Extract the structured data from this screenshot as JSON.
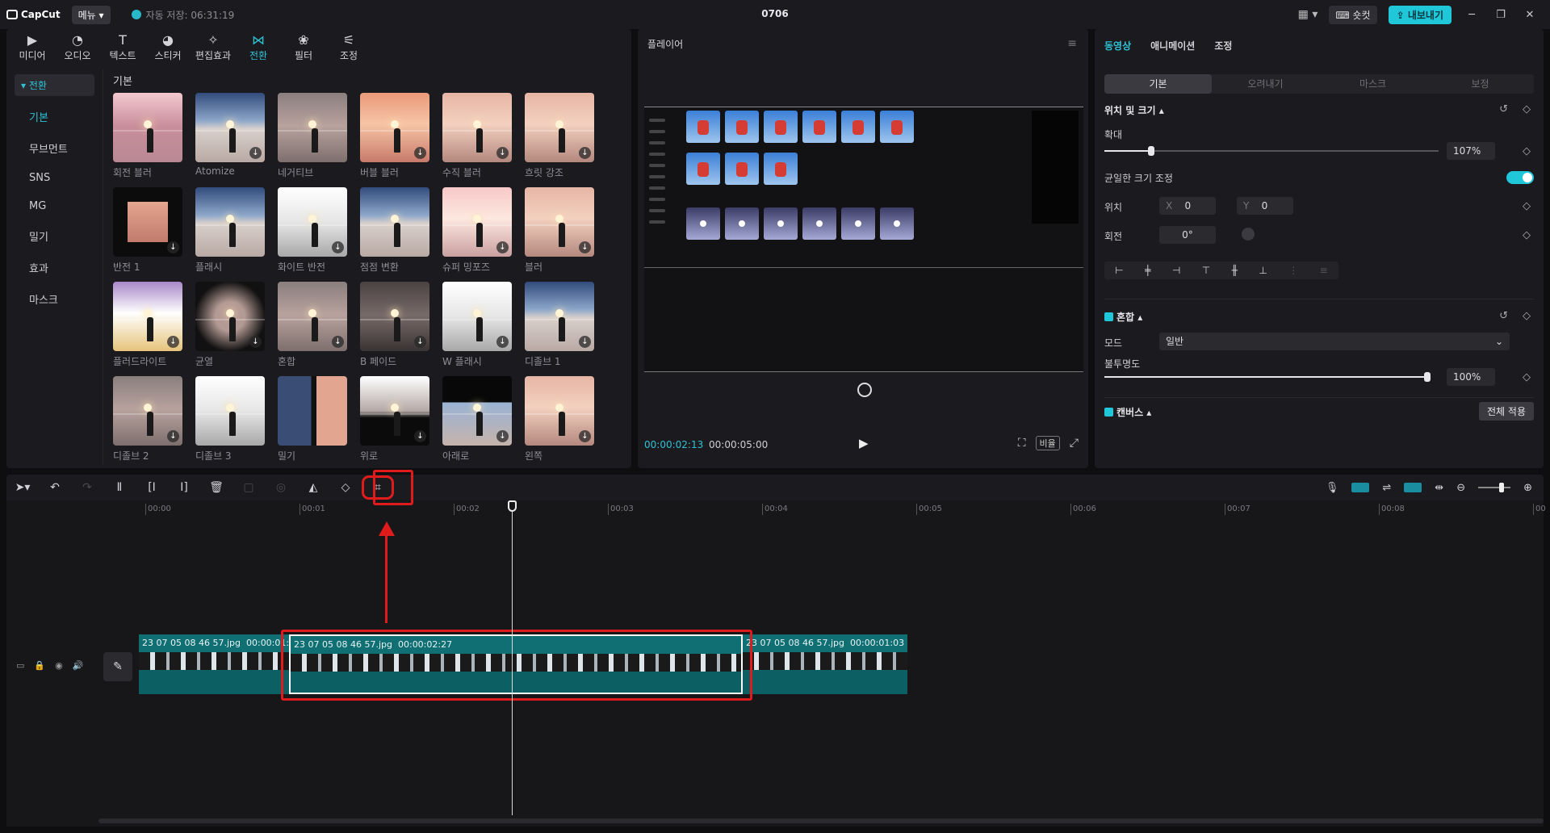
{
  "titlebar": {
    "logo": "CapCut",
    "menu": "메뉴",
    "autosave": "자동 저장: 06:31:19",
    "project_title": "0706",
    "shortcut": "숏컷",
    "export": "내보내기"
  },
  "categories": [
    {
      "label": "미디어",
      "icon": "media-icon"
    },
    {
      "label": "오디오",
      "icon": "audio-icon"
    },
    {
      "label": "텍스트",
      "icon": "text-icon"
    },
    {
      "label": "스티커",
      "icon": "sticker-icon"
    },
    {
      "label": "편집효과",
      "icon": "effects-icon"
    },
    {
      "label": "전환",
      "icon": "transition-icon"
    },
    {
      "label": "필터",
      "icon": "filter-icon"
    },
    {
      "label": "조정",
      "icon": "adjust-icon"
    }
  ],
  "active_category": "전환",
  "side_nav": {
    "header": "전환",
    "items": [
      "기본",
      "무브먼트",
      "SNS",
      "MG",
      "밀기",
      "효과",
      "마스크"
    ]
  },
  "transitions": {
    "section_title": "기본",
    "items": [
      {
        "label": "회전 블러",
        "download": false,
        "style": "pink"
      },
      {
        "label": "Atomize",
        "download": true,
        "style": "blue"
      },
      {
        "label": "네거티브",
        "download": false,
        "style": "grey"
      },
      {
        "label": "버블 블러",
        "download": true,
        "style": "orange"
      },
      {
        "label": "수직 블러",
        "download": true,
        "style": "peach"
      },
      {
        "label": "흐릿 강조",
        "download": true,
        "style": "peach"
      },
      {
        "label": "반전 1",
        "download": true,
        "style": "black"
      },
      {
        "label": "플래시",
        "download": false,
        "style": "blue"
      },
      {
        "label": "화이트 반전",
        "download": true,
        "style": "white"
      },
      {
        "label": "점점 변환",
        "download": false,
        "style": "blue"
      },
      {
        "label": "슈퍼 밍포즈",
        "download": true,
        "style": "pinkwhite"
      },
      {
        "label": "블러",
        "download": true,
        "style": "peach"
      },
      {
        "label": "플러드라이트",
        "download": true,
        "style": "purple"
      },
      {
        "label": "균열",
        "download": true,
        "style": "dark"
      },
      {
        "label": "혼합",
        "download": true,
        "style": "grey"
      },
      {
        "label": "B 페이드",
        "download": true,
        "style": "darkgrey"
      },
      {
        "label": "W 플래시",
        "download": true,
        "style": "white"
      },
      {
        "label": "디졸브 1",
        "download": true,
        "style": "blue"
      },
      {
        "label": "디졸브 2",
        "download": true,
        "style": "grey"
      },
      {
        "label": "디졸브 3",
        "download": false,
        "style": "white"
      },
      {
        "label": "밀기",
        "download": false,
        "style": "split"
      },
      {
        "label": "위로",
        "download": true,
        "style": "blackbottom"
      },
      {
        "label": "아래로",
        "download": true,
        "style": "blacktop"
      },
      {
        "label": "왼쪽",
        "download": true,
        "style": "peach"
      }
    ]
  },
  "player": {
    "title": "플레이어",
    "current_time": "00:00:02:13",
    "total_time": "00:00:05:00",
    "ratio_label": "비율"
  },
  "properties": {
    "tabs": [
      "동영상",
      "애니메이션",
      "조정"
    ],
    "active_tab": "동영상",
    "subtabs": [
      "기본",
      "오려내기",
      "마스크",
      "보정"
    ],
    "active_subtab": "기본",
    "position_size": "위치 및 크기",
    "scale_label": "확대",
    "scale_value": "107%",
    "scale_fraction": 0.14,
    "uniform_label": "균일한 크기 조정",
    "uniform_on": true,
    "position_label": "위치",
    "pos_x_label": "X",
    "pos_x": "0",
    "pos_y_label": "Y",
    "pos_y": "0",
    "rotation_label": "회전",
    "rotation_value": "0°",
    "blend_label": "혼합",
    "mode_label": "모드",
    "mode_value": "일반",
    "opacity_label": "불투명도",
    "opacity_value": "100%",
    "opacity_fraction": 1.0,
    "canvas_label": "캔버스",
    "apply_all": "전체 적용"
  },
  "timeline": {
    "ruler": [
      "00:00",
      "00:01",
      "00:02",
      "00:03",
      "00:04",
      "00:05",
      "00:06",
      "00:07",
      "00:08",
      "00"
    ],
    "clips": [
      {
        "label": "23 07 05 08 46 57.jpg",
        "duration": "00:00:01:0"
      },
      {
        "label": "23 07 05 08 46 57.jpg",
        "duration": "00:00:02:27"
      },
      {
        "label": "23 07 05 08 46 57.jpg",
        "duration": "00:00:01:03"
      }
    ]
  },
  "colors": {
    "accent": "#20c7d9",
    "clip": "#0f6f73",
    "highlight": "#e01b1b",
    "background": "#1b1b1f"
  }
}
